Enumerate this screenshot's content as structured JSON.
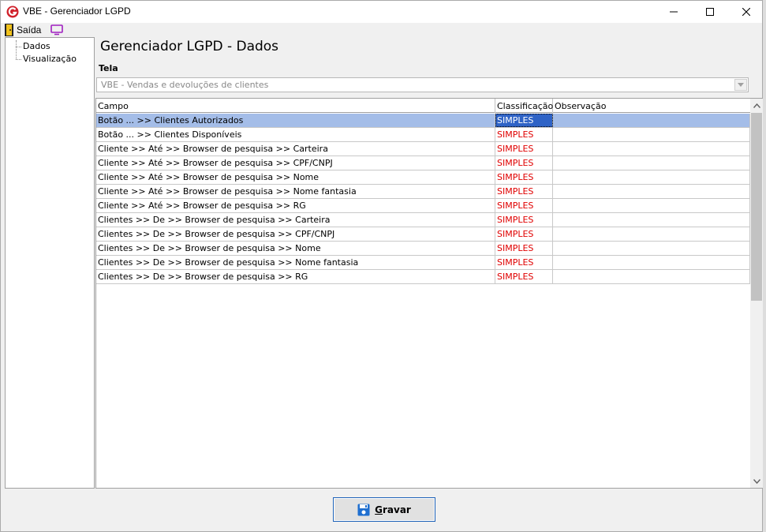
{
  "window": {
    "title": "VBE - Gerenciador LGPD",
    "minimize_glyph": "—",
    "maximize_glyph": "☐",
    "close_glyph": "✕"
  },
  "menu": {
    "exit_label": "Saída",
    "exit_icon": "door-exit-icon",
    "monitor_icon": "monitor-icon"
  },
  "sidebar": {
    "items": [
      {
        "label": "Dados"
      },
      {
        "label": "Visualização"
      }
    ]
  },
  "main": {
    "title": "Gerenciador LGPD - Dados",
    "tela_label": "Tela",
    "tela_value": "VBE - Vendas e devoluções de clientes"
  },
  "grid": {
    "columns": [
      "Campo",
      "Classificação",
      "Observação"
    ],
    "rows": [
      {
        "campo": "Botão ... >> Clientes Autorizados",
        "classificacao": "SIMPLES",
        "observacao": "",
        "selected": true
      },
      {
        "campo": "Botão ... >> Clientes Disponíveis",
        "classificacao": "SIMPLES",
        "observacao": ""
      },
      {
        "campo": "Cliente >> Até >> Browser de pesquisa >> Carteira",
        "classificacao": "SIMPLES",
        "observacao": ""
      },
      {
        "campo": "Cliente >> Até >> Browser de pesquisa >> CPF/CNPJ",
        "classificacao": "SIMPLES",
        "observacao": ""
      },
      {
        "campo": "Cliente >> Até >> Browser de pesquisa >> Nome",
        "classificacao": "SIMPLES",
        "observacao": ""
      },
      {
        "campo": "Cliente >> Até >> Browser de pesquisa >> Nome fantasia",
        "classificacao": "SIMPLES",
        "observacao": ""
      },
      {
        "campo": "Cliente >> Até >> Browser de pesquisa >> RG",
        "classificacao": "SIMPLES",
        "observacao": ""
      },
      {
        "campo": "Clientes >> De >> Browser de pesquisa >> Carteira",
        "classificacao": "SIMPLES",
        "observacao": ""
      },
      {
        "campo": "Clientes >> De >> Browser de pesquisa >> CPF/CNPJ",
        "classificacao": "SIMPLES",
        "observacao": ""
      },
      {
        "campo": "Clientes >> De >> Browser de pesquisa >> Nome",
        "classificacao": "SIMPLES",
        "observacao": ""
      },
      {
        "campo": "Clientes >> De >> Browser de pesquisa >> Nome fantasia",
        "classificacao": "SIMPLES",
        "observacao": ""
      },
      {
        "campo": "Clientes >> De >> Browser de pesquisa >> RG",
        "classificacao": "SIMPLES",
        "observacao": ""
      }
    ]
  },
  "footer": {
    "save_first": "G",
    "save_rest": "ravar",
    "save_icon": "floppy-disk-icon"
  },
  "colors": {
    "classification_text": "#e00000",
    "selected_row": "#a4bde8",
    "selected_cell": "#2f63c6",
    "brand_icon": "#d0202a"
  }
}
